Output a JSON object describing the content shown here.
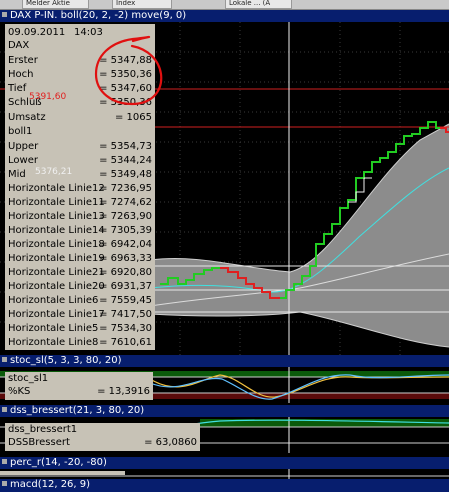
{
  "tabs": [
    "Melder Aktie",
    "Index",
    "Lokale ... (A"
  ],
  "main_panel": {
    "title": "DAX P-IN. boll(20, 2, -2) move(9, 0)",
    "info": {
      "date": "09.09.2011",
      "time": "14:03",
      "symbol": "DAX",
      "rows": [
        {
          "label": "Erster",
          "value": "= 5347,88"
        },
        {
          "label": "Hoch",
          "value": "= 5350,36"
        },
        {
          "label": "Tief",
          "value": "= 5347,60"
        },
        {
          "label": "Schluß",
          "value": "= 5350,36"
        },
        {
          "label": "Umsatz",
          "value": "= 1065"
        }
      ],
      "boll_name": "boll1",
      "boll_rows": [
        {
          "label": "Upper",
          "value": "= 5354,73"
        },
        {
          "label": "Lower",
          "value": "= 5344,24"
        },
        {
          "label": "Mid",
          "value": "= 5349,48"
        },
        {
          "label": "Horizontale Linie12",
          "value": "= 7236,95"
        },
        {
          "label": "Horizontale Linie11",
          "value": "= 7274,62"
        },
        {
          "label": "Horizontale Linie13",
          "value": "= 7263,90"
        },
        {
          "label": "Horizontale Linie14",
          "value": "= 7305,39"
        },
        {
          "label": "Horizontale Linie18",
          "value": "= 6942,04"
        },
        {
          "label": "Horizontale Linie19",
          "value": "= 6963,33"
        },
        {
          "label": "Horizontale Linie21",
          "value": "= 6920,80"
        },
        {
          "label": "Horizontale Linie20",
          "value": "= 6931,37"
        },
        {
          "label": "Horizontale Linie6",
          "value": "= 7559,45"
        },
        {
          "label": "Horizontale Linie17",
          "value": "= 7417,50"
        },
        {
          "label": "Horizontale Linie5",
          "value": "= 7534,30"
        },
        {
          "label": "Horizontale Linie8",
          "value": "= 7610,61"
        }
      ],
      "ghost_labels": [
        "5391,60",
        "5376,21"
      ]
    }
  },
  "stoc_panel": {
    "title": "stoc_sl(5, 3, 3, 80, 20)",
    "name": "stoc_sl1",
    "key": "%KS",
    "value": "= 13,3916"
  },
  "dss_panel": {
    "title": "dss_bressert(21, 3, 80, 20)",
    "name": "dss_bressert1",
    "key": "DSSBressert",
    "value": "= 63,0860"
  },
  "perc_panel": {
    "title": "perc_r(14, -20, -80)"
  },
  "macd_panel": {
    "title": "macd(12, 26, 9)"
  },
  "colors": {
    "title_bar": "#071e6e",
    "info_bg": "#c7c2b6",
    "bull_bar": "#22cc22",
    "bear_bar": "#e02020",
    "band_fill": "#8c8c8c",
    "mid_line": "#40e0e0",
    "annotation": "#e01010"
  }
}
